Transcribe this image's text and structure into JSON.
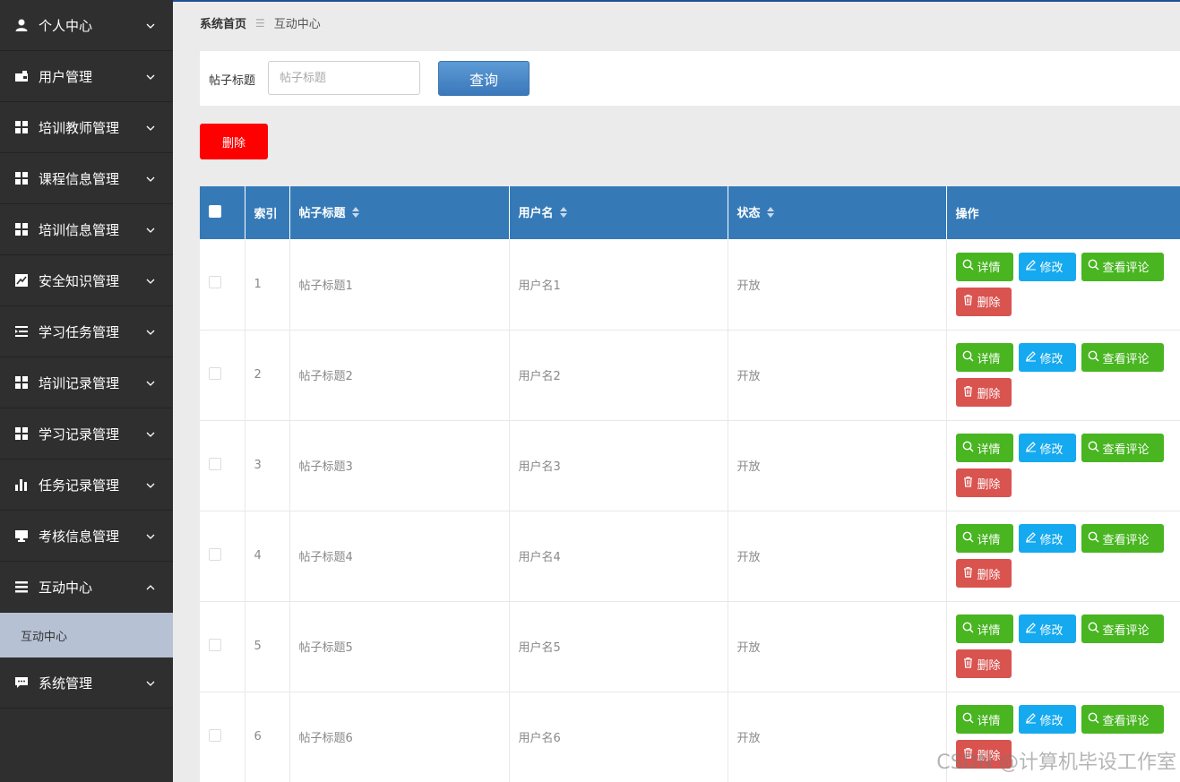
{
  "sidebar": {
    "items": [
      {
        "label": "个人中心",
        "icon": "user-icon",
        "expanded": false
      },
      {
        "label": "用户管理",
        "icon": "wallet-icon",
        "expanded": false
      },
      {
        "label": "培训教师管理",
        "icon": "grid-icon",
        "expanded": false
      },
      {
        "label": "课程信息管理",
        "icon": "grid-icon",
        "expanded": false
      },
      {
        "label": "培训信息管理",
        "icon": "grid-icon",
        "expanded": false
      },
      {
        "label": "安全知识管理",
        "icon": "line-chart-icon",
        "expanded": false
      },
      {
        "label": "学习任务管理",
        "icon": "indent-list-icon",
        "expanded": false
      },
      {
        "label": "培训记录管理",
        "icon": "grid-icon",
        "expanded": false
      },
      {
        "label": "学习记录管理",
        "icon": "grid-icon",
        "expanded": false
      },
      {
        "label": "任务记录管理",
        "icon": "bar-chart-icon",
        "expanded": false
      },
      {
        "label": "考核信息管理",
        "icon": "monitor-icon",
        "expanded": false
      },
      {
        "label": "互动中心",
        "icon": "list-icon",
        "expanded": true
      },
      {
        "label": "系统管理",
        "icon": "comment-icon",
        "expanded": false
      }
    ],
    "active_submenu": "互动中心"
  },
  "breadcrumb": {
    "home": "系统首页",
    "separator": "☰",
    "current": "互动中心"
  },
  "search": {
    "label": "帖子标题",
    "placeholder": "帖子标题",
    "value": "",
    "button": "查询"
  },
  "toolbar": {
    "delete_label": "删除"
  },
  "table": {
    "columns": [
      "索引",
      "帖子标题",
      "用户名",
      "状态",
      "操作"
    ],
    "rows": [
      {
        "index": "1",
        "title": "帖子标题1",
        "username": "用户名1",
        "status": "开放"
      },
      {
        "index": "2",
        "title": "帖子标题2",
        "username": "用户名2",
        "status": "开放"
      },
      {
        "index": "3",
        "title": "帖子标题3",
        "username": "用户名3",
        "status": "开放"
      },
      {
        "index": "4",
        "title": "帖子标题4",
        "username": "用户名4",
        "status": "开放"
      },
      {
        "index": "5",
        "title": "帖子标题5",
        "username": "用户名5",
        "status": "开放"
      },
      {
        "index": "6",
        "title": "帖子标题6",
        "username": "用户名6",
        "status": "开放"
      }
    ],
    "actions": {
      "detail": "详情",
      "edit": "修改",
      "comments": "查看评论",
      "delete": "删除"
    }
  },
  "colors": {
    "sidebar_bg": "#2f2f2f",
    "header_bg": "#357ab7",
    "green": "#48b521",
    "blue": "#15a9ef",
    "red": "#d9534f",
    "danger": "#ff0000"
  },
  "watermark": "CSDN @计算机毕设工作室"
}
